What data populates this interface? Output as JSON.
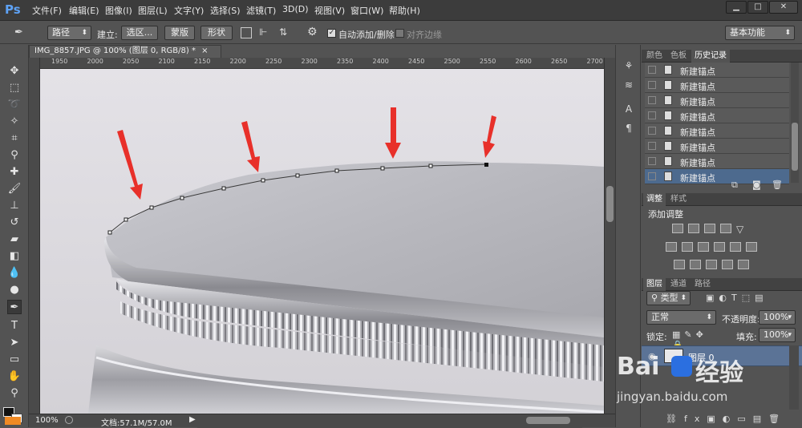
{
  "app": {
    "logo": "Ps"
  },
  "menu": [
    "文件(F)",
    "编辑(E)",
    "图像(I)",
    "图层(L)",
    "文字(Y)",
    "选择(S)",
    "滤镜(T)",
    "3D(D)",
    "视图(V)",
    "窗口(W)",
    "帮助(H)"
  ],
  "window_controls": {
    "minimize": "▁",
    "maximize": "□",
    "close": "✕"
  },
  "options": {
    "mode": "路径",
    "build_label": "建立:",
    "selection_btn": "选区...",
    "mask_btn": "蒙版",
    "shape_btn": "形状",
    "auto_add_delete": "自动添加/删除",
    "align_edges": "对齐边缘",
    "workspace": "基本功能"
  },
  "document": {
    "tab_title": "IMG_8857.JPG @ 100% (图层 0, RGB/8) *",
    "tab_close": "×",
    "ruler_ticks": [
      "1950",
      "2000",
      "2050",
      "2100",
      "2150",
      "2200",
      "2250",
      "2300",
      "2350",
      "2400",
      "2450",
      "2500",
      "2550",
      "2600",
      "2650",
      "2700"
    ],
    "zoom": "100%",
    "doc_info": "文档:57.1M/57.0M"
  },
  "tools": [
    "move-tool",
    "marquee-tool",
    "lasso-tool",
    "magic-wand-tool",
    "crop-tool",
    "eyedropper-tool",
    "healing-brush-tool",
    "brush-tool",
    "clone-stamp-tool",
    "history-brush-tool",
    "eraser-tool",
    "gradient-tool",
    "blur-tool",
    "dodge-tool",
    "pen-tool",
    "type-tool",
    "path-selection-tool",
    "shape-tool",
    "hand-tool",
    "zoom-tool"
  ],
  "history_panel": {
    "tabs": [
      "颜色",
      "色板",
      "历史记录"
    ],
    "active_tab": "历史记录",
    "items": [
      "新建锚点",
      "新建锚点",
      "新建锚点",
      "新建锚点",
      "新建锚点",
      "新建锚点",
      "新建锚点",
      "新建锚点"
    ],
    "selected_index": 7
  },
  "adjustments_panel": {
    "tabs": [
      "调整",
      "样式"
    ],
    "title": "添加调整"
  },
  "layers_panel": {
    "tabs": [
      "图层",
      "通道",
      "路径"
    ],
    "filter": "类型",
    "blend_mode": "正常",
    "opacity_label": "不透明度:",
    "opacity": "100%",
    "lock_label": "锁定:",
    "fill_label": "填充:",
    "fill": "100%",
    "layer_name": "图层 0"
  },
  "watermark": {
    "brand": "Bai",
    "brand2": "经验",
    "url": "jingyan.baidu.com"
  },
  "colors": {
    "accent": "#5ea2f5",
    "arrow": "#e8302a",
    "selection": "#4d6a8e"
  }
}
